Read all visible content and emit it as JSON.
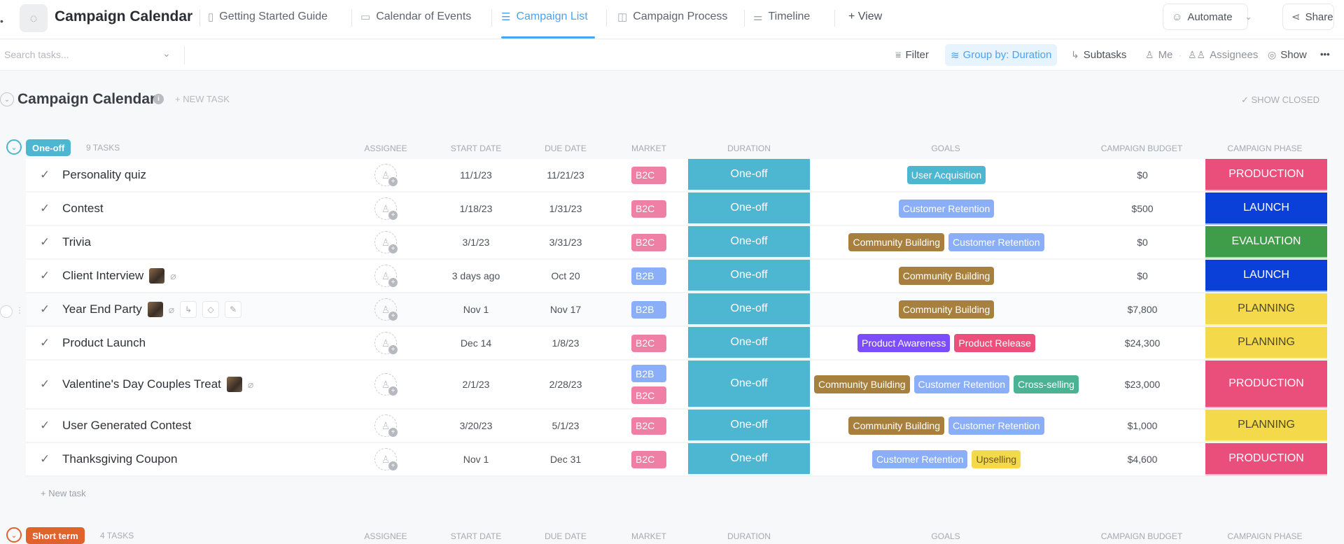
{
  "header": {
    "space_title": "Campaign Calendar",
    "tabs": [
      {
        "label": "Getting Started Guide",
        "icon": "doc-icon"
      },
      {
        "label": "Calendar of Events",
        "icon": "calendar-icon"
      },
      {
        "label": "Campaign List",
        "icon": "list-icon",
        "active": true
      },
      {
        "label": "Campaign Process",
        "icon": "board-icon"
      },
      {
        "label": "Timeline",
        "icon": "timeline-icon"
      }
    ],
    "add_view_label": "+ View",
    "automate_label": "Automate",
    "share_label": "Share"
  },
  "toolbar": {
    "search_placeholder": "Search tasks...",
    "filter_label": "Filter",
    "group_by_label": "Group by: Duration",
    "subtasks_label": "Subtasks",
    "me_label": "Me",
    "assignees_label": "Assignees",
    "show_label": "Show",
    "more_label": "•••"
  },
  "section": {
    "title": "Campaign Calendar",
    "new_task_label": "+ NEW TASK",
    "show_closed_label": "SHOW CLOSED"
  },
  "columns": {
    "assignee": "ASSIGNEE",
    "start_date": "START DATE",
    "due_date": "DUE DATE",
    "market": "MARKET",
    "duration": "DURATION",
    "goals": "GOALS",
    "budget": "CAMPAIGN BUDGET",
    "phase": "CAMPAIGN PHASE"
  },
  "colors": {
    "accent": "#4aa3f5",
    "one_off": "#4db6d0",
    "short_term": "#e0622c",
    "B2C": "#ef7fa5",
    "B2B": "#8aaff8",
    "User Acquisition": "#4db6d0",
    "Customer Retention": "#8aaff8",
    "Community Building": "#a8803d",
    "Product Awareness": "#7c4dff",
    "Product Release": "#ec4f7a",
    "Cross-selling": "#4bb394",
    "Upselling": "#f4d94a",
    "PRODUCTION": "#ea4f7c",
    "LAUNCH": "#0a3fd8",
    "EVALUATION": "#3f9d4a",
    "PLANNING": "#f4d94a"
  },
  "groups": [
    {
      "label": "One-off",
      "count_label": "9 TASKS",
      "new_task_label": "+ New task",
      "tasks": [
        {
          "name": "Personality quiz",
          "start": "11/1/23",
          "due": "11/21/23",
          "market": [
            "B2C"
          ],
          "duration": "One-off",
          "goals": [
            "User Acquisition"
          ],
          "budget": "$0",
          "phase": "PRODUCTION"
        },
        {
          "name": "Contest",
          "start": "1/18/23",
          "due": "1/31/23",
          "market": [
            "B2C"
          ],
          "duration": "One-off",
          "goals": [
            "Customer Retention"
          ],
          "budget": "$500",
          "phase": "LAUNCH"
        },
        {
          "name": "Trivia",
          "start": "3/1/23",
          "due": "3/31/23",
          "market": [
            "B2C"
          ],
          "duration": "One-off",
          "goals": [
            "Community Building",
            "Customer Retention"
          ],
          "budget": "$0",
          "phase": "EVALUATION"
        },
        {
          "name": "Client Interview",
          "start": "3 days ago",
          "due": "Oct 20",
          "market": [
            "B2B"
          ],
          "duration": "One-off",
          "goals": [
            "Community Building"
          ],
          "budget": "$0",
          "phase": "LAUNCH",
          "has_image": true,
          "has_attachment": true
        },
        {
          "name": "Year End Party",
          "start": "Nov 1",
          "due": "Nov 17",
          "market": [
            "B2B"
          ],
          "duration": "One-off",
          "goals": [
            "Community Building"
          ],
          "budget": "$7,800",
          "phase": "PLANNING",
          "has_image": true,
          "has_attachment": true,
          "hovered": true
        },
        {
          "name": "Product Launch",
          "start": "Dec 14",
          "due": "1/8/23",
          "market": [
            "B2C"
          ],
          "duration": "One-off",
          "goals": [
            "Product Awareness",
            "Product Release"
          ],
          "budget": "$24,300",
          "phase": "PLANNING"
        },
        {
          "name": "Valentine's Day Couples Treat",
          "start": "2/1/23",
          "due": "2/28/23",
          "market": [
            "B2B",
            "B2C"
          ],
          "duration": "One-off",
          "goals": [
            "Community Building",
            "Customer Retention",
            "Cross-selling"
          ],
          "budget": "$23,000",
          "phase": "PRODUCTION",
          "has_image": true,
          "has_attachment": true,
          "tall": true
        },
        {
          "name": "User Generated Contest",
          "start": "3/20/23",
          "due": "5/1/23",
          "market": [
            "B2C"
          ],
          "duration": "One-off",
          "goals": [
            "Community Building",
            "Customer Retention"
          ],
          "budget": "$1,000",
          "phase": "PLANNING"
        },
        {
          "name": "Thanksgiving Coupon",
          "start": "Nov 1",
          "due": "Dec 31",
          "market": [
            "B2C"
          ],
          "duration": "One-off",
          "goals": [
            "Customer Retention",
            "Upselling"
          ],
          "budget": "$4,600",
          "phase": "PRODUCTION"
        }
      ]
    },
    {
      "label": "Short term",
      "count_label": "4 TASKS"
    }
  ]
}
